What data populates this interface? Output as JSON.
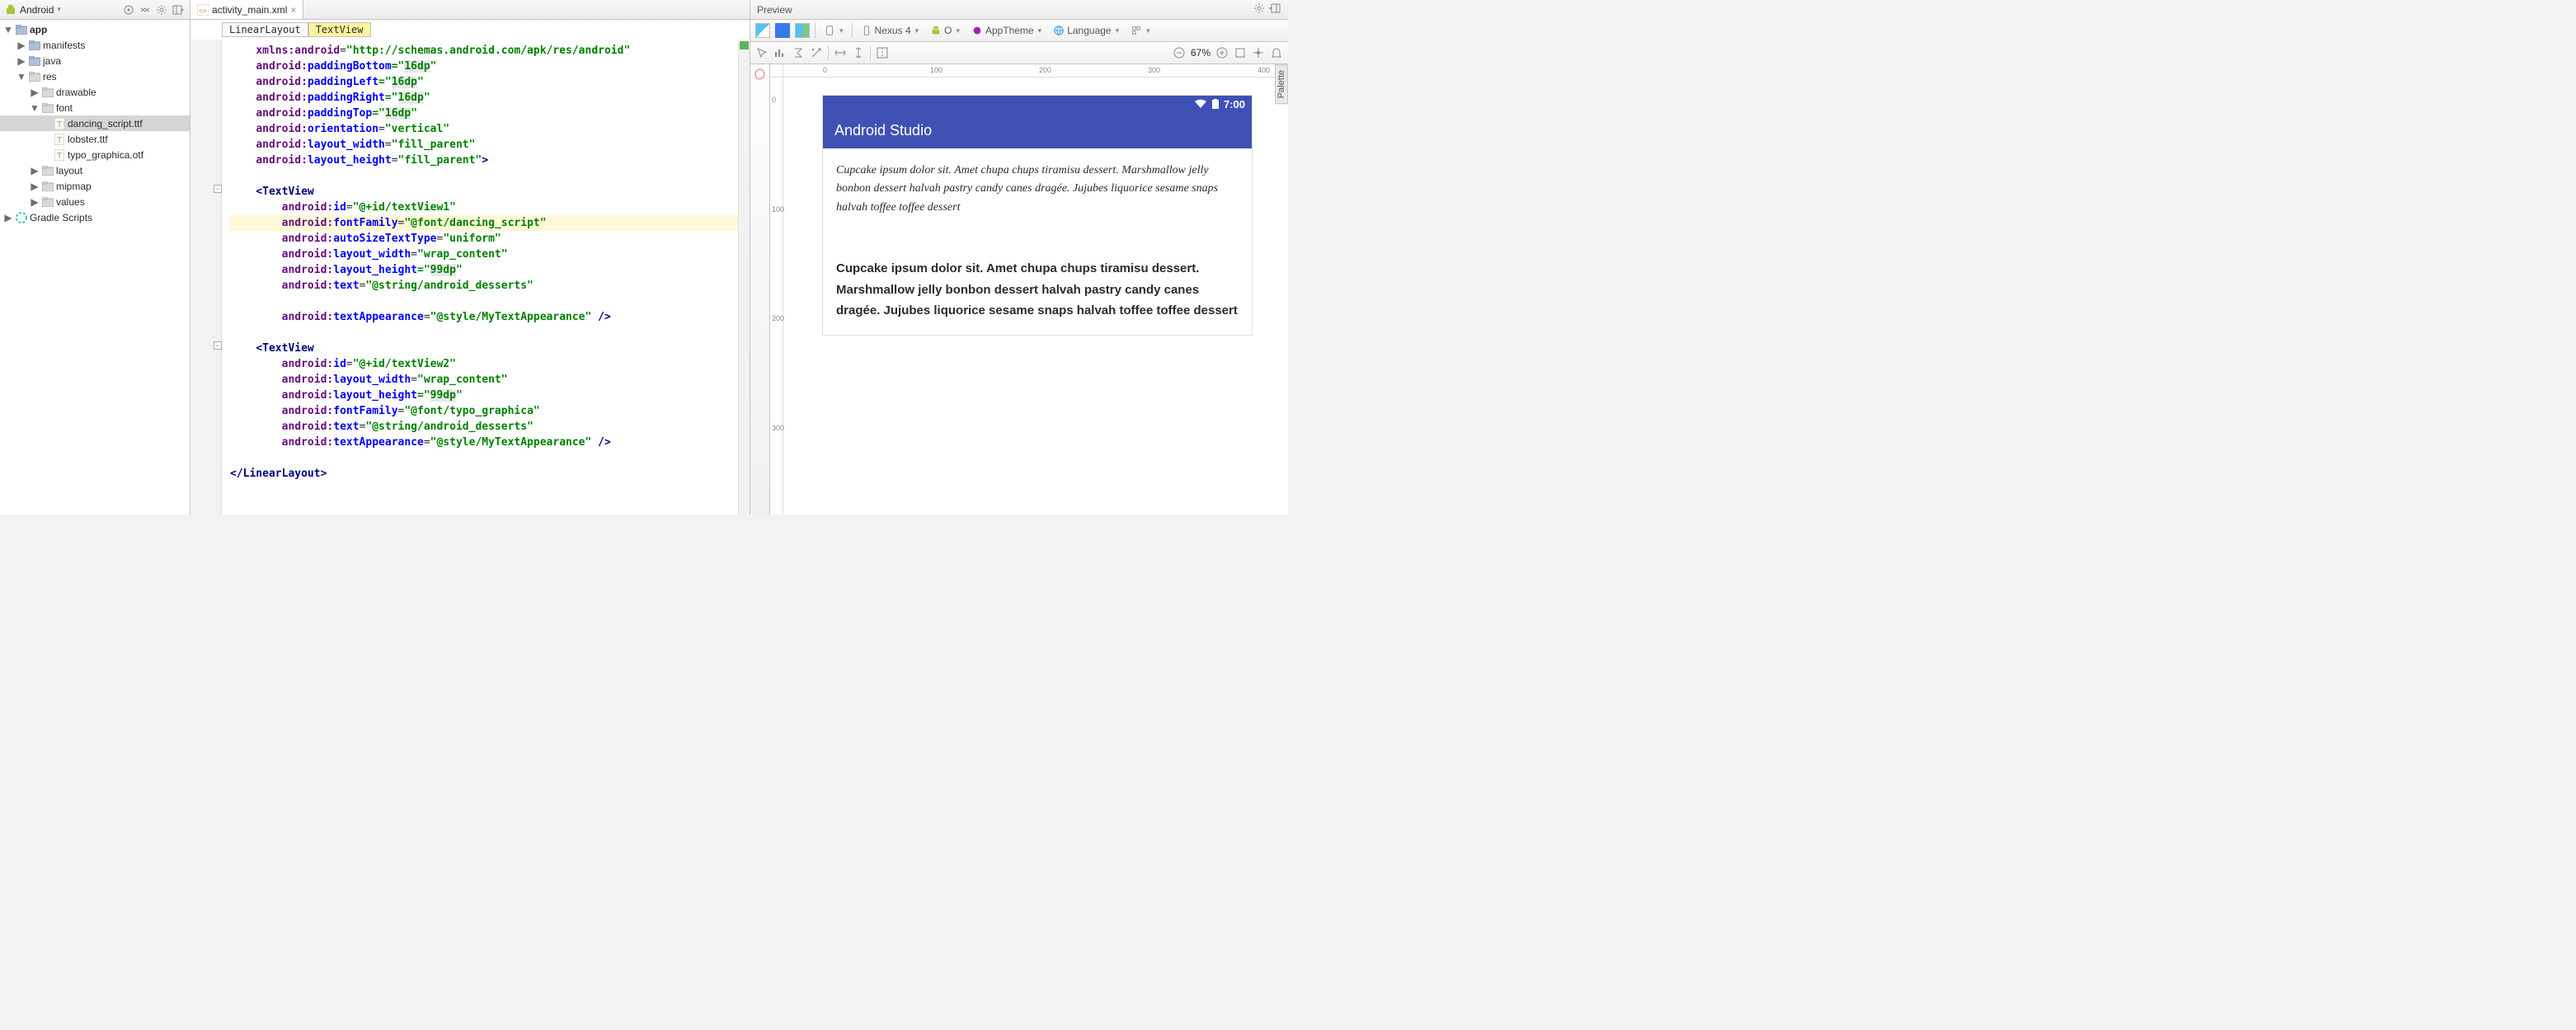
{
  "leftToolbar": {
    "title": "Android"
  },
  "tree": {
    "app": "app",
    "manifests": "manifests",
    "java": "java",
    "res": "res",
    "drawable": "drawable",
    "font": "font",
    "dancing": "dancing_script.ttf",
    "lobster": "lobster.ttf",
    "typo": "typo_graphica.otf",
    "layout": "layout",
    "mipmap": "mipmap",
    "values": "values",
    "gradle": "Gradle Scripts"
  },
  "tab": {
    "name": "activity_main.xml",
    "close": "×"
  },
  "breadcrumb": {
    "ll": "LinearLayout",
    "tv": "TextView"
  },
  "code": {
    "l1a": "xmlns:",
    "l1b": "android",
    "l1c": "=",
    "l1d": "\"http://schemas.android.com/apk/res/android\"",
    "l2a": "android:",
    "l2b": "paddingBottom",
    "l2c": "=\"",
    "l2d": "16dp",
    "l2e": "\"",
    "l3b": "paddingLeft",
    "l3d": "16dp",
    "l4b": "paddingRight",
    "l4d": "16dp",
    "l5b": "paddingTop",
    "l5d": "16dp",
    "l6b": "orientation",
    "l6d": "\"vertical\"",
    "l7b": "layout_width",
    "l7d": "\"fill_parent\"",
    "l8b": "layout_height",
    "l8d": "\"fill_parent\"",
    "l8e": ">",
    "t1open": "<",
    "t1tag": "TextView",
    "t1_id_a": "android:",
    "t1_id_b": "id",
    "t1_id_v": "\"@+id/textView1\"",
    "t1_ff_b": "fontFamily",
    "t1_ff_v": "\"@font/dancing_script\"",
    "t1_as_b": "autoSizeTextType",
    "t1_as_v": "\"uniform\"",
    "t1_lw_v": "\"wrap_content\"",
    "t1_lh_v": "99dp",
    "t1_tx_b": "text",
    "t1_tx_v": "\"@string/android_desserts\"",
    "t1_ta_b": "textAppearance",
    "t1_ta_v": "\"@style/MyTextAppearance\"",
    "t1_close": " />",
    "t2_id_v": "\"@+id/textView2\"",
    "t2_ff_v": "\"@font/typo_graphica\"",
    "llclose_a": "</",
    "llclose_b": "LinearLayout",
    "llclose_c": ">"
  },
  "preview": {
    "title": "Preview",
    "device": "Nexus 4",
    "api": "O",
    "theme": "AppTheme",
    "lang": "Language",
    "zoom": "67%",
    "appTitle": "Android Studio",
    "clock": "7:00",
    "text1": "Cupcake ipsum dolor sit. Amet chupa chups tiramisu dessert. Marshmallow jelly bonbon dessert halvah pastry candy canes dragée. Jujubes liquorice sesame snaps halvah toffee toffee dessert",
    "text2": "Cupcake ipsum dolor sit. Amet chupa chups tiramisu dessert. Marshmallow jelly bonbon dessert halvah pastry candy canes dragée. Jujubes liquorice sesame snaps halvah toffee toffee dessert",
    "paletteTab": "Palette",
    "ruler": {
      "r0": "0",
      "r100": "100",
      "r200": "200",
      "r300": "300",
      "r400": "400"
    }
  }
}
